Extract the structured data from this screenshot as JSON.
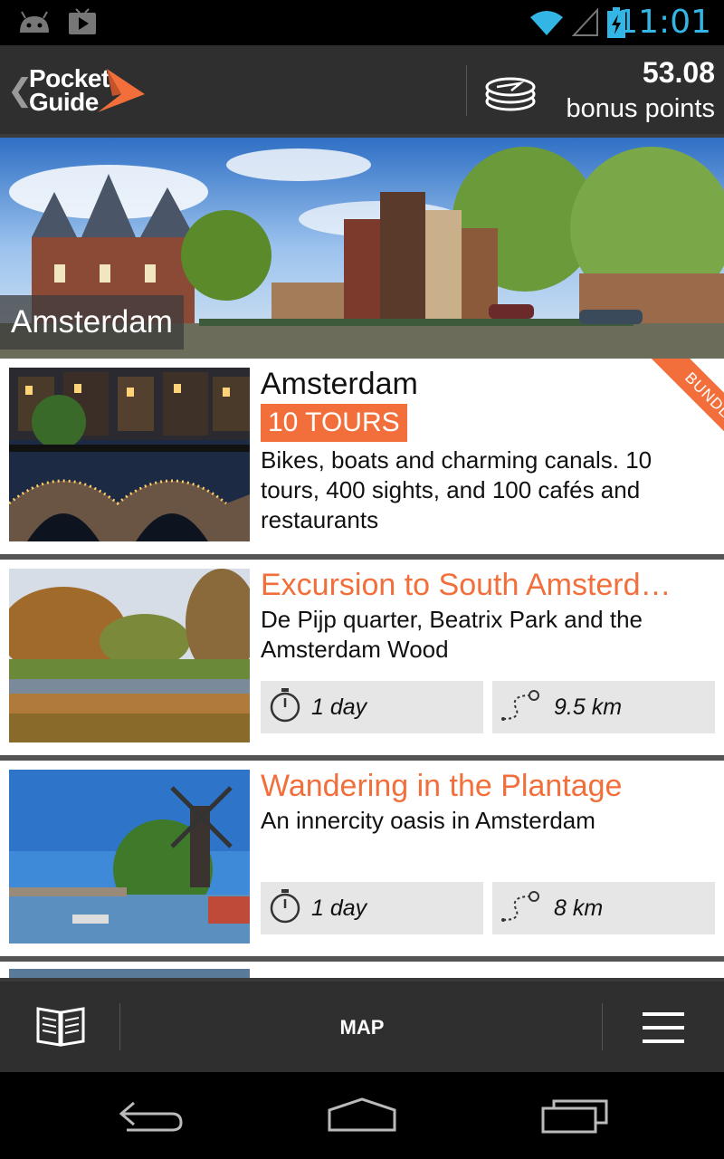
{
  "status_bar": {
    "time": "11:01",
    "icons": [
      "android-icon",
      "play-store-icon",
      "wifi-icon",
      "signal-icon",
      "battery-charging-icon"
    ]
  },
  "header": {
    "back_icon": "chevron-left-icon",
    "logo_line1": "Pocket",
    "logo_line2": "Guide",
    "points_value": "53.08",
    "points_label": "bonus points"
  },
  "hero": {
    "city": "Amsterdam"
  },
  "cards": [
    {
      "title": "Amsterdam",
      "badge": "10 TOURS",
      "ribbon": "BUNDLE",
      "description": "Bikes, boats and charming canals. 10 tours, 400 sights, and 100 cafés and restaurants"
    },
    {
      "title": "Excursion to South Amsterd…",
      "description": "De Pijp quarter, Beatrix Park and the Amsterdam Wood",
      "duration": "1 day",
      "distance": "9.5 km"
    },
    {
      "title": "Wandering in the Plantage",
      "description": "An innercity oasis in Amsterdam",
      "duration": "1 day",
      "distance": "8 km"
    }
  ],
  "bottom_bar": {
    "map_label": "MAP"
  },
  "colors": {
    "accent": "#f26f3b",
    "bar": "#2f2f2f",
    "time": "#33b5e5"
  }
}
